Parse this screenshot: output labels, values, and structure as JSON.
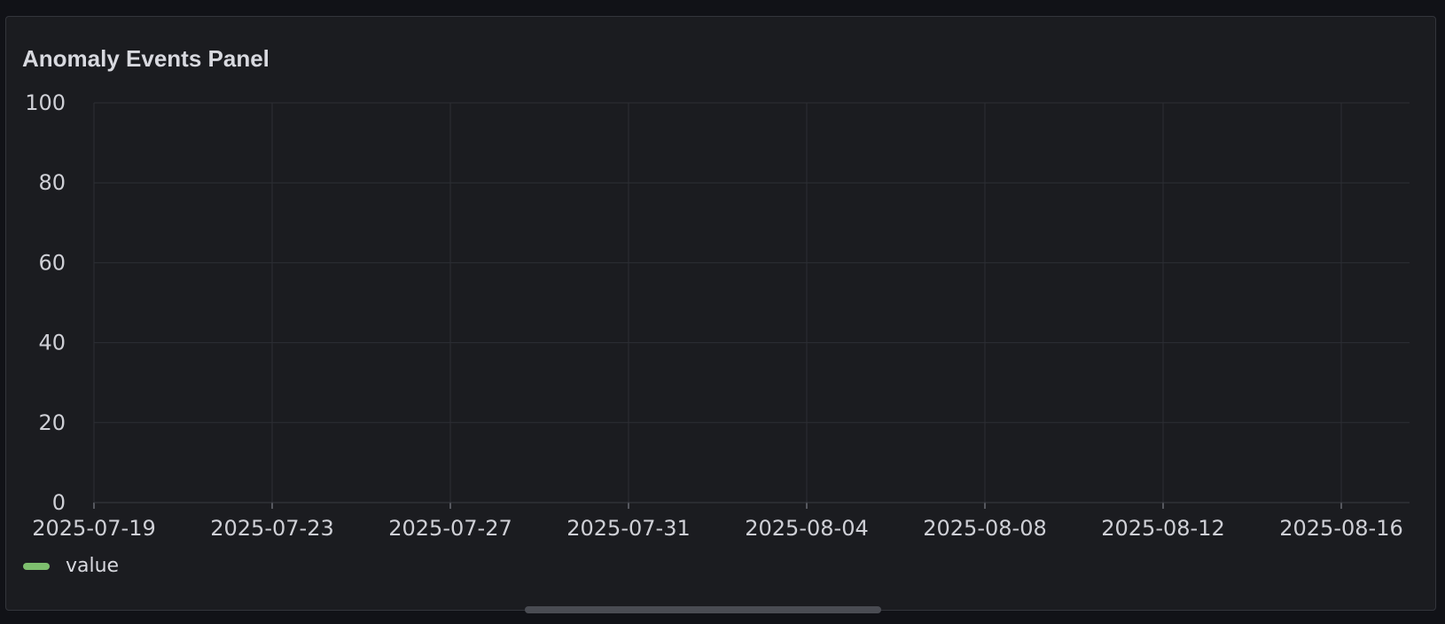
{
  "panel": {
    "title": "Anomaly Events Panel"
  },
  "colors": {
    "background": "#111217",
    "panel_bg": "#1b1c20",
    "grid": "#2c2e34",
    "text": "#cfd0d6",
    "series_value": "#7ebf6e"
  },
  "chart_data": {
    "type": "line",
    "title": "Anomaly Events Panel",
    "xlabel": "",
    "ylabel": "",
    "x_tick_labels": [
      "2025-07-19",
      "2025-07-23",
      "2025-07-27",
      "2025-07-31",
      "2025-08-04",
      "2025-08-08",
      "2025-08-12",
      "2025-08-16"
    ],
    "y_tick_labels": [
      "0",
      "20",
      "40",
      "60",
      "80",
      "100"
    ],
    "ylim": [
      0,
      100
    ],
    "xlim": [
      "2025-07-19",
      "2025-08-17"
    ],
    "grid": true,
    "legend_placement": "bottom-left",
    "series": [
      {
        "name": "value",
        "color": "#7ebf6e",
        "x": [],
        "y": []
      }
    ]
  },
  "legend": {
    "items": [
      {
        "label": "value",
        "color": "#7ebf6e"
      }
    ]
  }
}
